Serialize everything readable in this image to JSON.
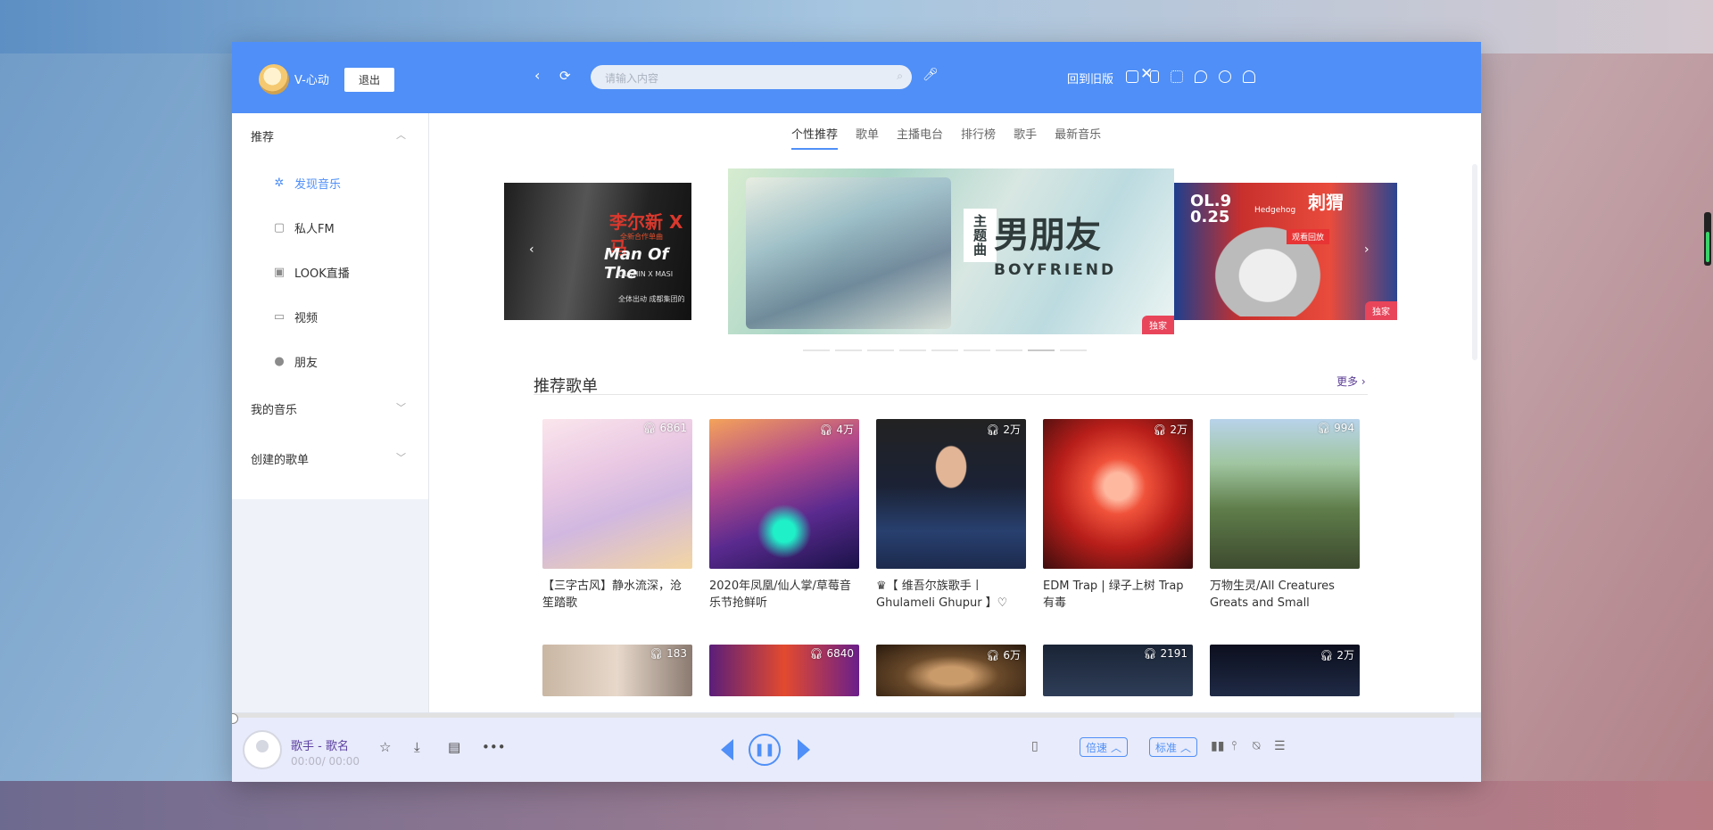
{
  "header": {
    "username": "V-心动",
    "logout_label": "退出",
    "search_placeholder": "请输入内容",
    "old_version_label": "回到旧版"
  },
  "sidebar": {
    "recommend_title": "推荐",
    "items": [
      {
        "label": "发现音乐",
        "icon": "sparkle-icon"
      },
      {
        "label": "私人FM",
        "icon": "radio-icon"
      },
      {
        "label": "LOOK直播",
        "icon": "camera-icon"
      },
      {
        "label": "视频",
        "icon": "video-icon"
      },
      {
        "label": "朋友",
        "icon": "user-icon"
      }
    ],
    "my_music_title": "我的音乐",
    "created_playlists_title": "创建的歌单"
  },
  "tabs": [
    "个性推荐",
    "歌单",
    "主播电台",
    "排行榜",
    "歌手",
    "最新音乐"
  ],
  "banners": {
    "left": {
      "title": "李尔新 X 马",
      "subtitle": "Man Of The",
      "line": "全新合作单曲",
      "sub_en": "LILSHIN X MASI",
      "footer": "全体出动 成都集团的"
    },
    "center": {
      "title_box": "主题曲",
      "title": "男朋友",
      "subtitle": "BOYFRIEND",
      "tag": "独家"
    },
    "right": {
      "date1": "OL.9",
      "date2": "0.25",
      "name": "Hedgehog",
      "cn_title": "刺猬",
      "replay": "观看回放",
      "tag": "独家"
    }
  },
  "section": {
    "title": "推荐歌单",
    "more": "更多"
  },
  "playlists": [
    {
      "count": "6861",
      "name": "【三字古风】静水流深，沧笙踏歌"
    },
    {
      "count": "4万",
      "name": "2020年凤凰/仙人掌/草莓音乐节抢鲜听"
    },
    {
      "count": "2万",
      "name": "♛【 维吾尔族歌手丨Ghulameli Ghupur 】♡"
    },
    {
      "count": "2万",
      "name": "EDM Trap | 绿子上树 Trap有毒"
    },
    {
      "count": "994",
      "name": "万物生灵/All Creatures Greats and Small"
    }
  ],
  "playlists_row2": [
    {
      "count": "183"
    },
    {
      "count": "6840"
    },
    {
      "count": "6万"
    },
    {
      "count": "2191"
    },
    {
      "count": "2万"
    }
  ],
  "player": {
    "song": "歌手 - 歌名",
    "time": "00:00/ 00:00",
    "speed_label": "倍速",
    "quality_label": "标准"
  },
  "colors": {
    "accent": "#4f8ff7",
    "player_bg": "#e8ebfb",
    "tag_red": "#e8455a"
  }
}
